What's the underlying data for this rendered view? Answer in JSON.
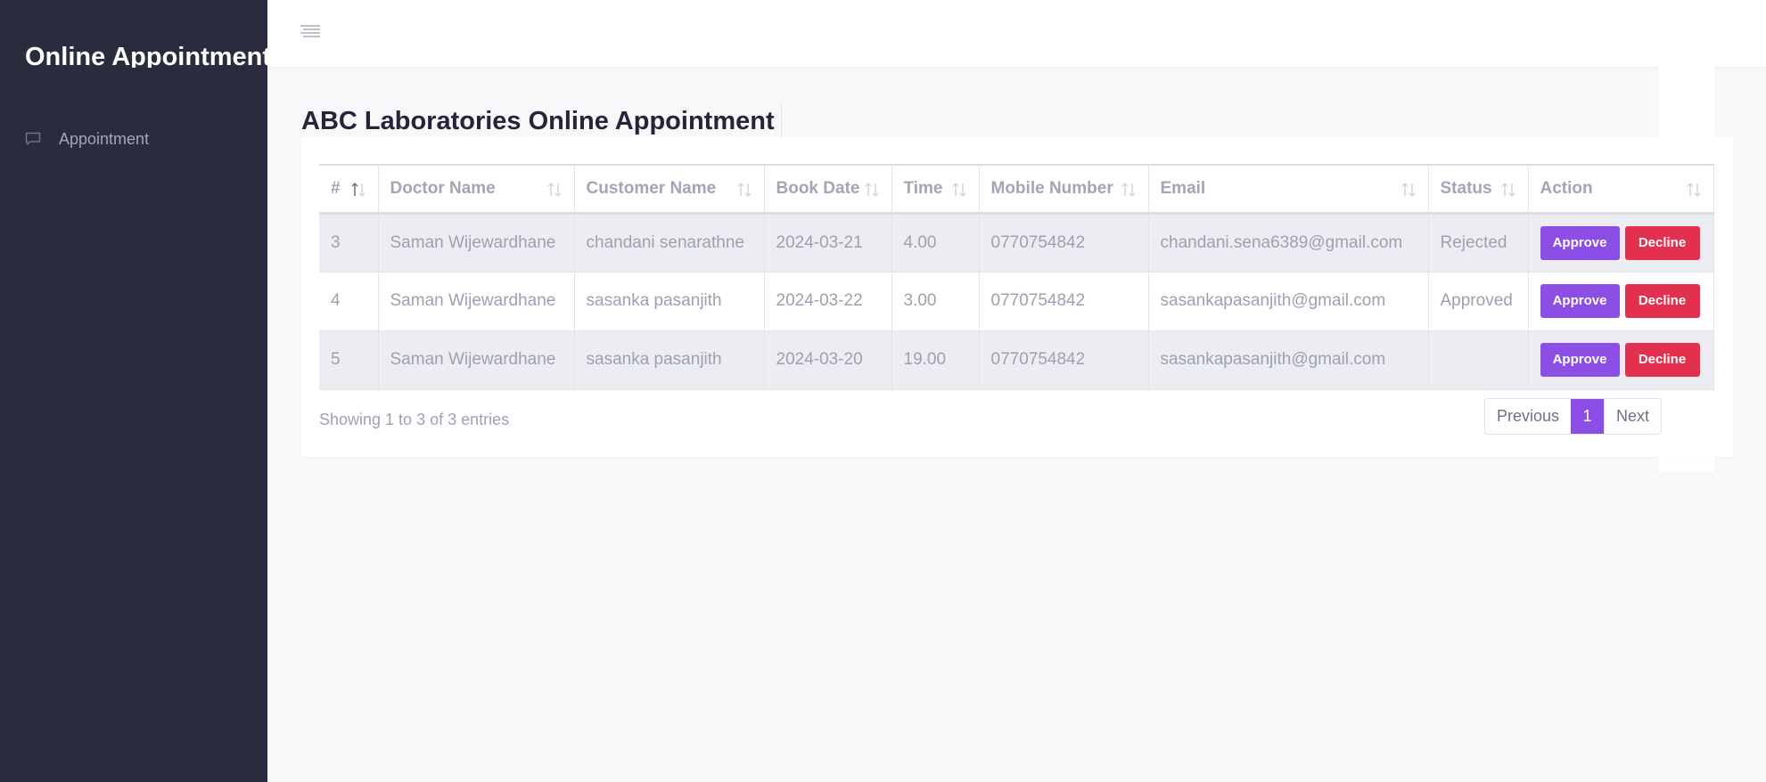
{
  "sidebar": {
    "brand": "Online Appointment",
    "items": [
      {
        "label": "Appointment",
        "icon": "message-square-icon"
      }
    ]
  },
  "topbar": {
    "menu_icon": "menu-lines-icon"
  },
  "page": {
    "title": "ABC Laboratories Online Appointment"
  },
  "table": {
    "columns": [
      "#",
      "Doctor Name",
      "Customer Name",
      "Book Date",
      "Time",
      "Mobile Number",
      "Email",
      "Status",
      "Action"
    ],
    "rows": [
      {
        "id": "3",
        "doctor": "Saman Wijewardhane",
        "customer": "chandani senarathne",
        "date": "2024-03-21",
        "time": "4.00",
        "mobile": "0770754842",
        "email": "chandani.sena6389@gmail.com",
        "status": "Rejected"
      },
      {
        "id": "4",
        "doctor": "Saman Wijewardhane",
        "customer": "sasanka pasanjith",
        "date": "2024-03-22",
        "time": "3.00",
        "mobile": "0770754842",
        "email": "sasankapasanjith@gmail.com",
        "status": "Approved"
      },
      {
        "id": "5",
        "doctor": "Saman Wijewardhane",
        "customer": "sasanka pasanjith",
        "date": "2024-03-20",
        "time": "19.00",
        "mobile": "0770754842",
        "email": "sasankapasanjith@gmail.com",
        "status": ""
      }
    ],
    "approve_label": "Approve",
    "decline_label": "Decline"
  },
  "footer": {
    "info": "Showing 1 to 3 of 3 entries",
    "pagination": {
      "previous": "Previous",
      "current": "1",
      "next": "Next"
    }
  },
  "colors": {
    "sidebar_bg": "#2a2b3c",
    "accent": "#8c4ee4",
    "danger": "#e3304e",
    "page_bg": "#f8f8fb"
  }
}
